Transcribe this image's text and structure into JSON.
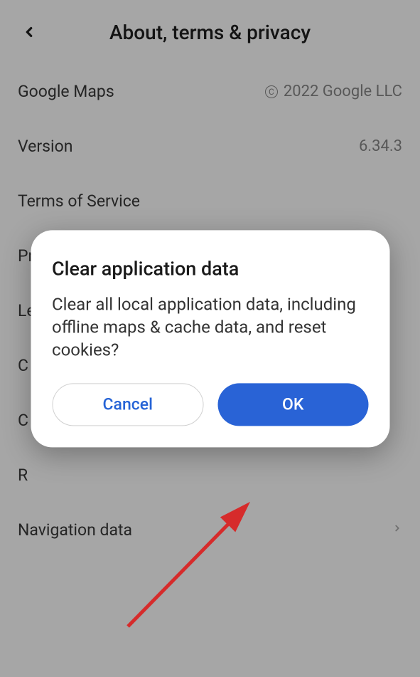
{
  "header": {
    "title": "About, terms & privacy"
  },
  "rows": {
    "app": {
      "label": "Google Maps",
      "value": "2022 Google LLC"
    },
    "version": {
      "label": "Version",
      "value": "6.34.3"
    },
    "terms": {
      "label": "Terms of Service"
    },
    "privacy": {
      "label": "Privacy Policy"
    },
    "legal": {
      "label": "Le"
    },
    "c1": {
      "label": "C"
    },
    "c2": {
      "label": "C"
    },
    "r": {
      "label": "R"
    },
    "nav": {
      "label": "Navigation data"
    }
  },
  "dialog": {
    "title": "Clear application data",
    "body": "Clear all local application data, including offline maps & cache data, and reset cookies?",
    "cancel": "Cancel",
    "ok": "OK"
  }
}
